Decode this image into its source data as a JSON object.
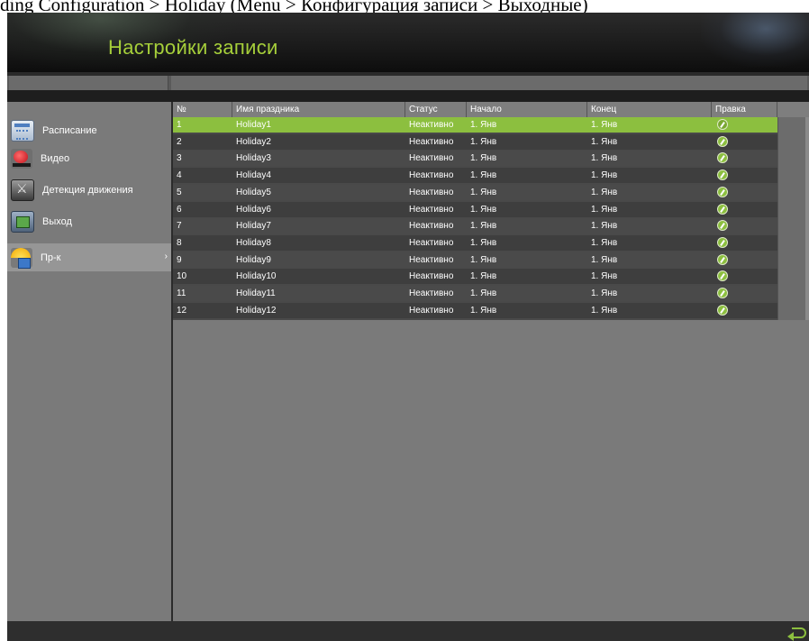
{
  "caption": "ding Configuration > Holiday (Menu > Конфигурация записи > Выходные)",
  "header": {
    "title": "Настройки записи"
  },
  "sidebar": {
    "items": [
      {
        "label": "Расписание",
        "icon": "calendar-icon",
        "active": false
      },
      {
        "label": "Видео",
        "icon": "record-icon",
        "active": false
      },
      {
        "label": "Детекция движения",
        "icon": "motion-detection-icon",
        "active": false
      },
      {
        "label": "Выход",
        "icon": "output-icon",
        "active": false
      },
      {
        "label": "Пр-к",
        "icon": "holiday-icon",
        "active": true,
        "chevron": "›"
      }
    ]
  },
  "table": {
    "columns": [
      "№",
      "Имя праздника",
      "Статус",
      "Начало",
      "Конец",
      "Правка"
    ],
    "rows": [
      {
        "no": "1",
        "name": "Holiday1",
        "status": "Неактивно",
        "start": "1. Янв",
        "end": "1. Янв",
        "selected": true
      },
      {
        "no": "2",
        "name": "Holiday2",
        "status": "Неактивно",
        "start": "1. Янв",
        "end": "1. Янв"
      },
      {
        "no": "3",
        "name": "Holiday3",
        "status": "Неактивно",
        "start": "1. Янв",
        "end": "1. Янв"
      },
      {
        "no": "4",
        "name": "Holiday4",
        "status": "Неактивно",
        "start": "1. Янв",
        "end": "1. Янв"
      },
      {
        "no": "5",
        "name": "Holiday5",
        "status": "Неактивно",
        "start": "1. Янв",
        "end": "1. Янв"
      },
      {
        "no": "6",
        "name": "Holiday6",
        "status": "Неактивно",
        "start": "1. Янв",
        "end": "1. Янв"
      },
      {
        "no": "7",
        "name": "Holiday7",
        "status": "Неактивно",
        "start": "1. Янв",
        "end": "1. Янв"
      },
      {
        "no": "8",
        "name": "Holiday8",
        "status": "Неактивно",
        "start": "1. Янв",
        "end": "1. Янв"
      },
      {
        "no": "9",
        "name": "Holiday9",
        "status": "Неактивно",
        "start": "1. Янв",
        "end": "1. Янв"
      },
      {
        "no": "10",
        "name": "Holiday10",
        "status": "Неактивно",
        "start": "1. Янв",
        "end": "1. Янв"
      },
      {
        "no": "11",
        "name": "Holiday11",
        "status": "Неактивно",
        "start": "1. Янв",
        "end": "1. Янв"
      },
      {
        "no": "12",
        "name": "Holiday12",
        "status": "Неактивно",
        "start": "1. Янв",
        "end": "1. Янв"
      }
    ],
    "edit_icon": "edit-pencil-icon"
  },
  "footer": {
    "back_icon": "back-arrow-icon"
  },
  "colors": {
    "accent": "#8cbf3f",
    "title": "#a6cf3a",
    "row_even": "#4a4a4a",
    "row_odd": "#3e3e3e"
  }
}
